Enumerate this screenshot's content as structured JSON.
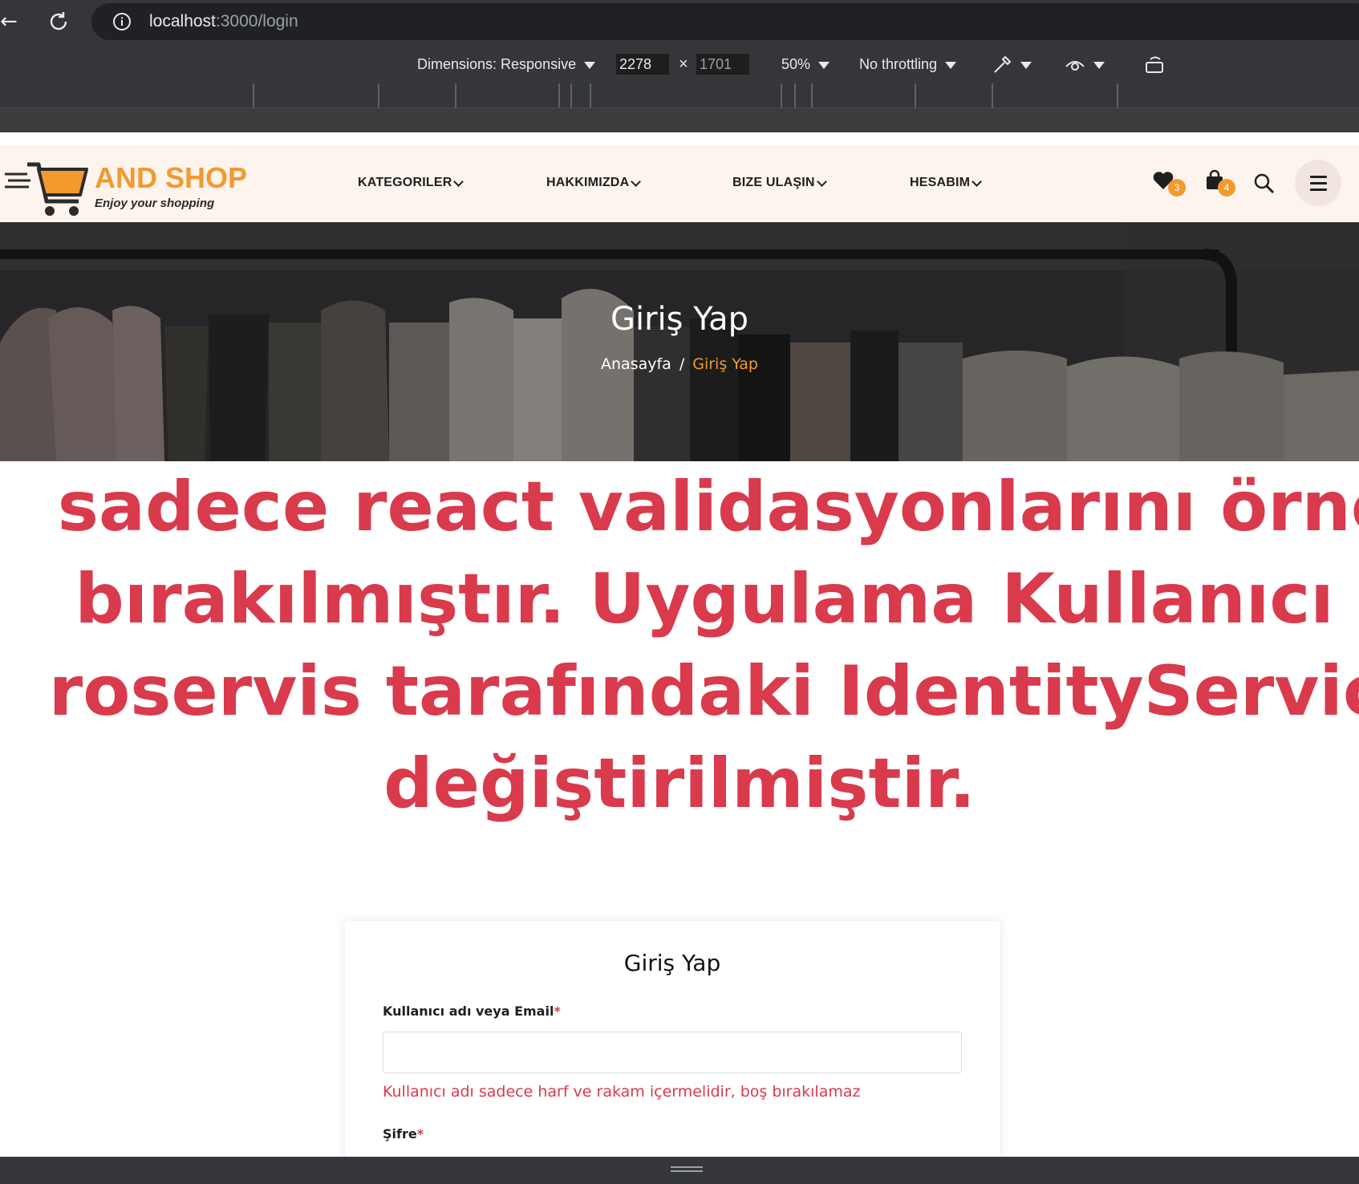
{
  "browser": {
    "url_host": "localhost",
    "url_path": ":3000/login"
  },
  "device_toolbar": {
    "dimensions_label": "Dimensions: Responsive",
    "width": "2278",
    "times": "×",
    "height": "1701",
    "zoom": "50%",
    "throttling": "No throttling"
  },
  "site": {
    "logo_title": "AND SHOP",
    "logo_tagline": "Enjoy your shopping",
    "menu": [
      "KATEGORILER",
      "HAKKIMIZDA",
      "BIZE ULAŞIN",
      "HESABIM"
    ],
    "wishlist_count": "3",
    "cart_count": "4",
    "brand_color": "#f29a2e",
    "error_color": "#d93a4c"
  },
  "hero": {
    "title": "Giriş Yap",
    "crumb_home": "Anasayfa",
    "crumb_sep": "/",
    "crumb_current": "Giriş Yap"
  },
  "notice": {
    "lines": [
      "sadece react validasyonlarını örne",
      "bırakılmıştır. Uygulama Kullanıcı a",
      "roservis tarafındaki IdentityService",
      "değiştirilmiştir."
    ]
  },
  "login": {
    "title": "Giriş Yap",
    "username_label": "Kullanıcı adı veya Email",
    "required_mark": "*",
    "username_value": "",
    "username_error": "Kullanıcı adı sadece harf ve rakam içermelidir, boş bırakılamaz",
    "password_label": "Şifre"
  }
}
